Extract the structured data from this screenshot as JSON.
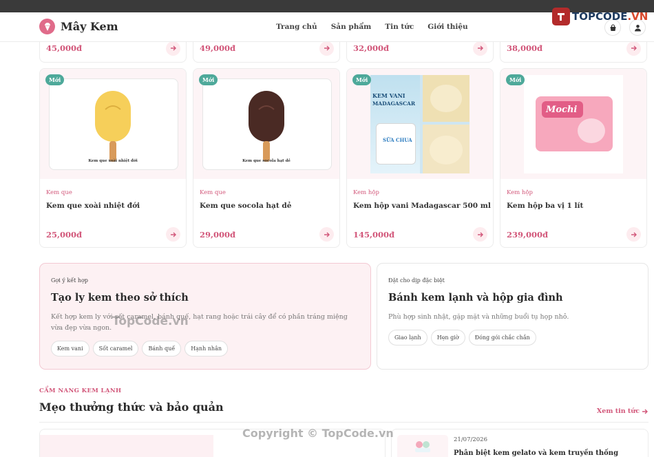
{
  "brand": {
    "name": "Mây Kem"
  },
  "nav": {
    "items": [
      "Trang chủ",
      "Sản phẩm",
      "Tin tức",
      "Giới thiệu"
    ]
  },
  "watermark_logo": {
    "text_main": "TOPCODE",
    "text_suffix": ".VN"
  },
  "top_prices": [
    "45,000đ",
    "49,000đ",
    "32,000đ",
    "38,000đ"
  ],
  "products": [
    {
      "badge": "Mới",
      "category": "Kem que",
      "name": "Kem que xoài nhiệt đới",
      "price": "25,000đ",
      "image_caption": "Kem que xoài nhiệt đới",
      "image_color": "#f6cf5a"
    },
    {
      "badge": "Mới",
      "category": "Kem que",
      "name": "Kem que socola hạt dẻ",
      "price": "29,000đ",
      "image_caption": "Kem que socola hạt dẻ",
      "image_color": "#4a2a24"
    },
    {
      "badge": "Mới",
      "category": "Kem hộp",
      "name": "Kem hộp vani Madagascar 500 ml",
      "price": "145,000đ",
      "image_text1": "KEM VANI",
      "image_text2": "MADAGASCAR",
      "image_text3": "SỮA CHUA"
    },
    {
      "badge": "Mới",
      "category": "Kem hộp",
      "name": "Kem hộp ba vị 1 lít",
      "price": "239,000đ",
      "image_text": "Mochi"
    }
  ],
  "promo1": {
    "kicker": "Gợi ý kết hợp",
    "title": "Tạo ly kem theo sở thích",
    "desc": "Kết hợp kem ly với sốt caramel, bánh quế, hạt rang hoặc trái cây để có phần tráng miệng vừa đẹp vừa ngon.",
    "chips": [
      "Kem vani",
      "Sốt caramel",
      "Bánh quế",
      "Hạnh nhân"
    ]
  },
  "promo2": {
    "kicker": "Đặt cho dịp đặc biệt",
    "title": "Bánh kem lạnh và hộp gia đình",
    "desc": "Phù hợp sinh nhật, gặp mặt và những buổi tụ họp nhỏ.",
    "chips": [
      "Giao lạnh",
      "Hẹn giờ",
      "Đóng gói chắc chắn"
    ]
  },
  "guide": {
    "kicker": "CẨM NANG KEM LẠNH",
    "title": "Mẹo thưởng thức và bảo quản",
    "link": "Xem tin tức"
  },
  "article": {
    "date": "21/07/2026",
    "title": "Phân biệt kem gelato và kem truyền thống"
  },
  "watermarks": {
    "mid": "TopCode.vn",
    "bottom": "Copyright © TopCode.vn"
  },
  "colors": {
    "accent": "#d2577a",
    "badge": "#4ea99a",
    "header_strip": "#3a3a3a"
  }
}
